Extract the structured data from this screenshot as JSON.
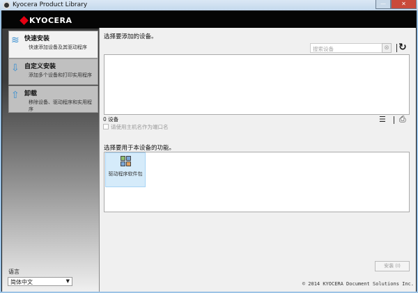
{
  "window": {
    "title": "Kyocera Product Library",
    "minimize": "—",
    "close": "✕"
  },
  "logo": "KYOCERA",
  "sidebar": {
    "items": [
      {
        "title": "快速安装",
        "desc": "快速添加设备及其驱动程序",
        "icon": "quick-install-icon",
        "glyph": "≋"
      },
      {
        "title": "自定义安装",
        "desc": "添加多个设备和打印实用程序",
        "icon": "custom-install-icon",
        "glyph": "⇩"
      },
      {
        "title": "卸载",
        "desc": "移除设备、驱动程序和实用程序",
        "icon": "uninstall-icon",
        "glyph": "⇧"
      }
    ]
  },
  "main": {
    "select_device_label": "选择要添加的设备。",
    "search_placeholder": "搜索设备",
    "clear": "⊗",
    "refresh": "↻",
    "device_count": "0 设备",
    "use_hostname_label": "请使用主机名作为端口名",
    "list_glyph": "☰",
    "printer_glyph": "⎙",
    "features_label": "选择要用于本设备的功能。",
    "features": [
      {
        "name": "驱动程序软件包"
      }
    ],
    "install_button": "安装 (I)"
  },
  "language": {
    "label": "语言",
    "selected": "简体中文",
    "arrow": "▼"
  },
  "copyright": "© 2014 KYOCERA Document Solutions Inc."
}
